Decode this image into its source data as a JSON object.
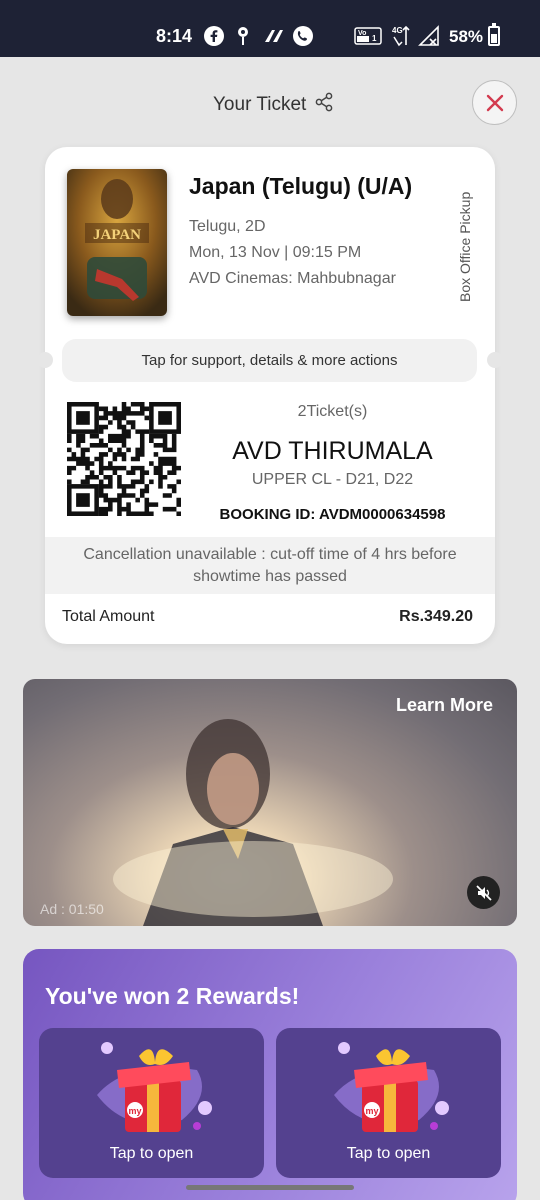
{
  "status_bar": {
    "time": "8:14",
    "battery": "58%",
    "battery_level": 0.58,
    "icons": [
      "facebook-icon",
      "location-icon",
      "phonepe-icon",
      "whatsapp-call-icon",
      "volte-icon",
      "4g-signal-icon",
      "no-signal-icon",
      "battery-icon"
    ],
    "volte_label": "Vo LTE 1",
    "network_label": "4G"
  },
  "header": {
    "title": "Your Ticket",
    "share_icon": "share-icon",
    "close_icon": "close-icon",
    "close_color": "#d33b4f"
  },
  "ticket": {
    "poster_text": "JAPAN",
    "movie_title": "Japan (Telugu) (U/A)",
    "language_format": "Telugu, 2D",
    "datetime": "Mon, 13 Nov | 09:15 PM",
    "venue": "AVD Cinemas: Mahbubnagar",
    "pickup_label": "Box Office Pickup",
    "support_text": "Tap for support, details & more actions",
    "ticket_count": "2Ticket(s)",
    "screen_name": "AVD THIRUMALA",
    "seats": "UPPER CL - D21, D22",
    "booking_id": "BOOKING ID: AVDM0000634598",
    "cancellation_line1": "Cancellation unavailable : cut-off time of 4 hrs before",
    "cancellation_line2": "showtime has passed",
    "total_label": "Total Amount",
    "total_value": "Rs.349.20"
  },
  "ad": {
    "learn_more": "Learn More",
    "timer": "Ad : 01:50",
    "mute_icon": "mute-icon"
  },
  "rewards": {
    "title": "You've won 2 Rewards!",
    "cards": [
      {
        "label": "Tap to open",
        "icon": "gift-icon"
      },
      {
        "label": "Tap to open",
        "icon": "gift-icon"
      }
    ],
    "accent": "#7656c0"
  }
}
